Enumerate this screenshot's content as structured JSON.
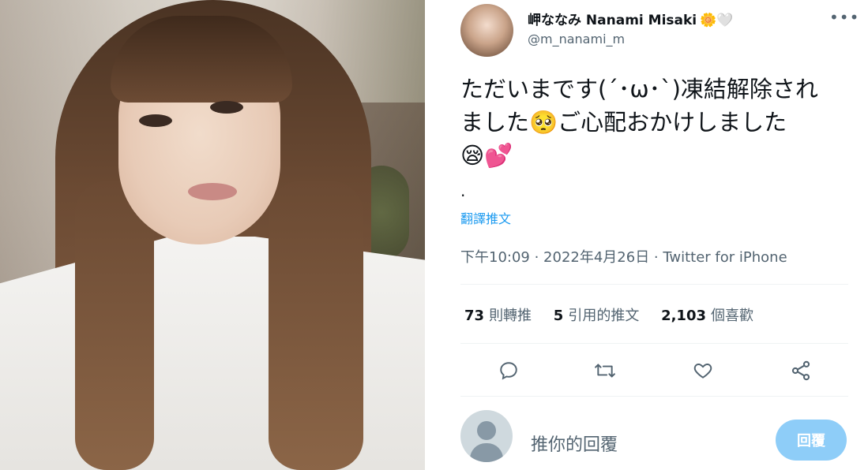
{
  "user": {
    "display_name": "岬ななみ Nanami Misaki",
    "emoji_after_name": "🌼🤍",
    "handle": "@m_nanami_m"
  },
  "more_label": "•••",
  "tweet": {
    "lines": [
      "ただいまです(´･ω･`)凍結解除され",
      "ました🥺ご心配おかけしました",
      "😪💕"
    ],
    "dot": ".",
    "translate_label": "翻譯推文",
    "meta": "下午10:09 · 2022年4月26日 · Twitter for iPhone"
  },
  "stats": {
    "retweets_count": "73",
    "retweets_label": "則轉推",
    "quotes_count": "5",
    "quotes_label": "引用的推文",
    "likes_count": "2,103",
    "likes_label": "個喜歡"
  },
  "reply": {
    "placeholder": "推你的回覆",
    "button_label": "回覆"
  },
  "colors": {
    "accent": "#1d9bf0",
    "reply_button_disabled": "#8ecdf8",
    "secondary_text": "#536471",
    "divider": "#eff3f4"
  },
  "icons": [
    "reply-icon",
    "retweet-icon",
    "like-icon",
    "share-icon",
    "more-icon",
    "default-avatar-icon"
  ]
}
